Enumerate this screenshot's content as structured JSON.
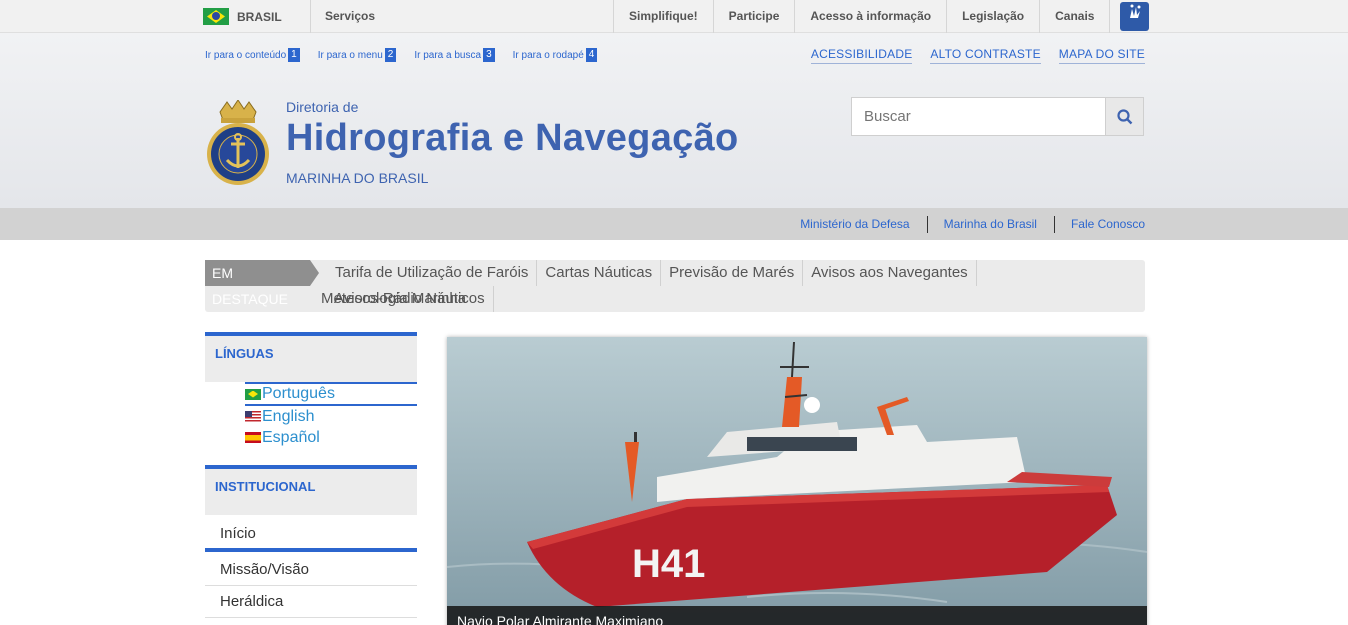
{
  "gov_bar": {
    "brasil_label": "BRASIL",
    "servicos_label": "Serviços",
    "links": [
      "Simplifique!",
      "Participe",
      "Acesso à informação",
      "Legislação",
      "Canais"
    ]
  },
  "skip_links": [
    {
      "label": "Ir para o conteúdo",
      "num": "1"
    },
    {
      "label": "Ir para o menu",
      "num": "2"
    },
    {
      "label": "Ir para a busca",
      "num": "3"
    },
    {
      "label": "Ir para o rodapé",
      "num": "4"
    }
  ],
  "accessibility": [
    "ACESSIBILIDADE",
    "ALTO CONTRASTE",
    "MAPA DO SITE"
  ],
  "site": {
    "title_pre": "Diretoria de",
    "title_main": "Hidrografia e Navegação",
    "title_sub": "MARINHA DO BRASIL"
  },
  "search": {
    "placeholder": "Buscar"
  },
  "service_links": [
    "Ministério da Defesa",
    "Marinha do Brasil",
    "Fale Conosco"
  ],
  "destaque": {
    "tag": "EM DESTAQUE",
    "items": [
      "Tarifa de Utilização de Faróis",
      "Cartas Náuticas",
      "Previsão de Marés",
      "Avisos aos Navegantes",
      "Avisos-Rádio Náuticos",
      "Meteorologia Marinha"
    ]
  },
  "sidebar": {
    "linguas_title": "LÍNGUAS",
    "languages": [
      "Português",
      "English",
      "Español"
    ],
    "institucional_title": "INSTITUCIONAL",
    "items": [
      "Início",
      "Missão/Visão",
      "Heráldica"
    ]
  },
  "carousel": {
    "caption": "Navio Polar Almirante Maximiano",
    "hull_number": "H41"
  },
  "colors": {
    "primary_blue": "#3e63b0",
    "link_blue": "#2c66ce",
    "ship_red": "#b5202a"
  }
}
